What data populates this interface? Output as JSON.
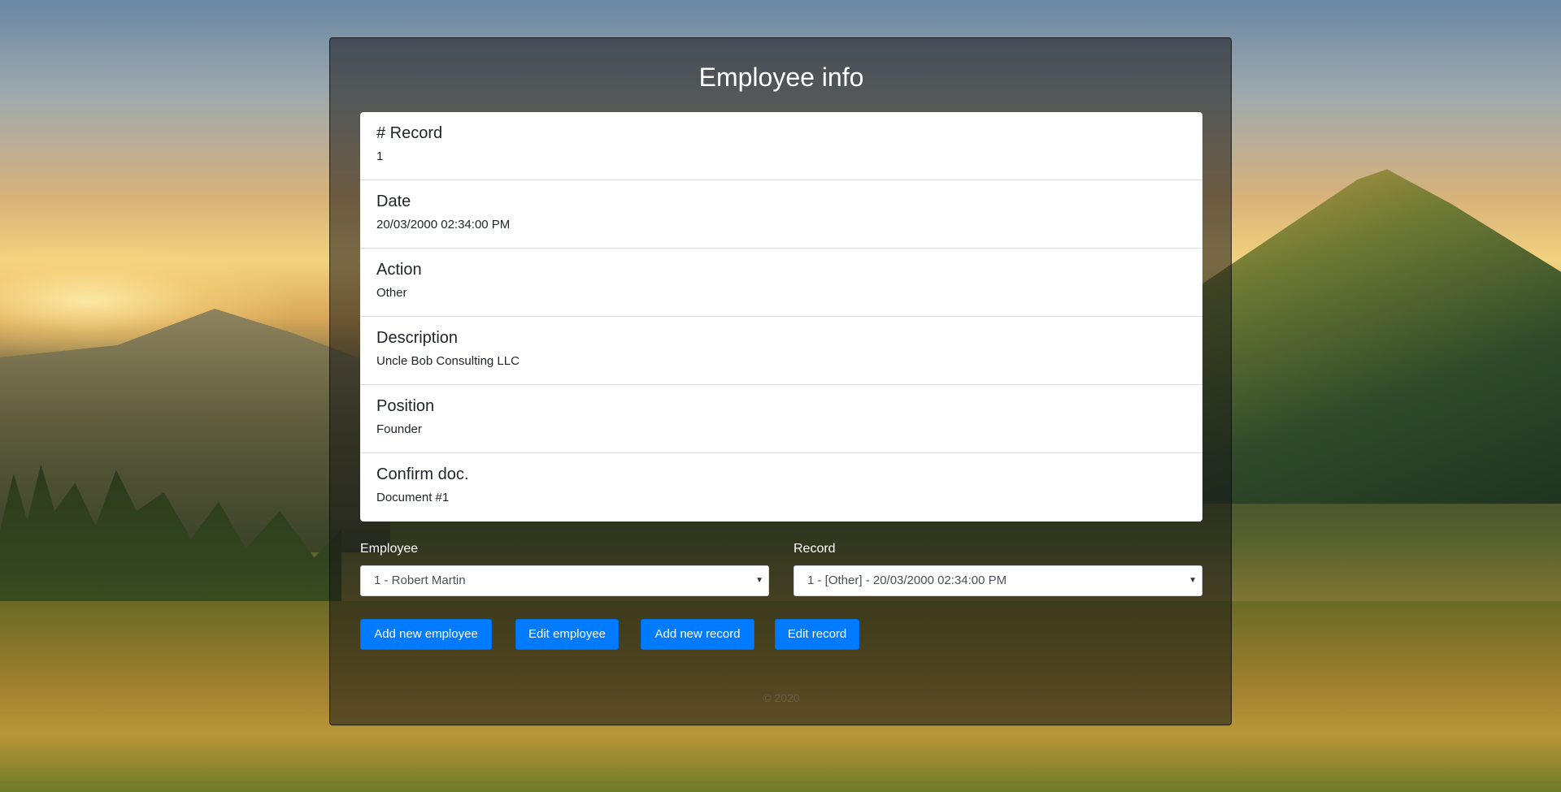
{
  "page": {
    "title": "Employee info",
    "footer": "© 2020"
  },
  "record": {
    "items": [
      {
        "label": "# Record",
        "value": "1"
      },
      {
        "label": "Date",
        "value": "20/03/2000 02:34:00 PM"
      },
      {
        "label": "Action",
        "value": "Other"
      },
      {
        "label": "Description",
        "value": "Uncle Bob Consulting LLC"
      },
      {
        "label": "Position",
        "value": "Founder"
      },
      {
        "label": "Confirm doc.",
        "value": "Document #1"
      }
    ]
  },
  "selectors": {
    "employee": {
      "label": "Employee",
      "value": "1 - Robert Martin"
    },
    "record": {
      "label": "Record",
      "value": "1 - [Other] - 20/03/2000 02:34:00 PM"
    }
  },
  "buttons": {
    "add_employee": "Add new employee",
    "edit_employee": "Edit employee",
    "add_record": "Add new record",
    "edit_record": "Edit record"
  },
  "colors": {
    "primary": "#007bff",
    "panel_overlay": "rgba(20,20,20,0.55)"
  }
}
